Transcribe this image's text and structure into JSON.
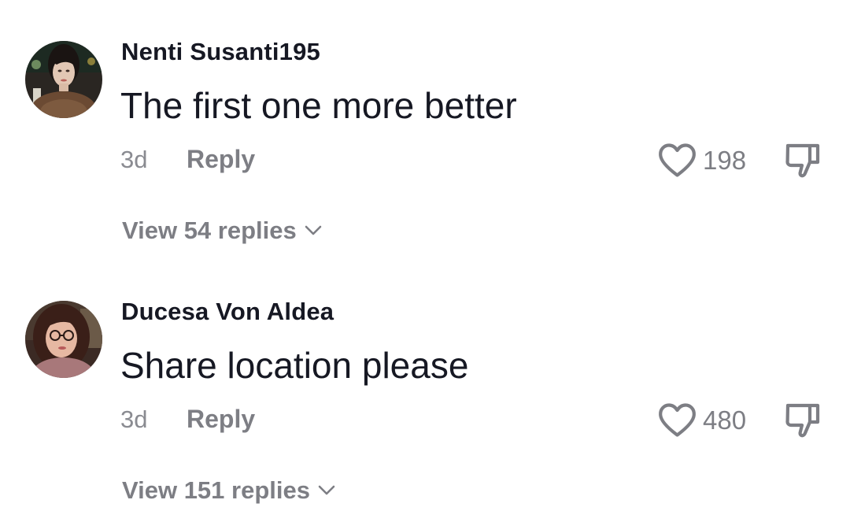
{
  "comments": [
    {
      "username": "Nenti Susanti195",
      "text": "The first one more better",
      "time": "3d",
      "reply_label": "Reply",
      "likes": "198",
      "view_replies": "View 54 replies",
      "avatar_icon": "user-avatar-photo"
    },
    {
      "username": "Ducesa Von Aldea",
      "text": "Share location please",
      "time": "3d",
      "reply_label": "Reply",
      "likes": "480",
      "view_replies": "View 151 replies",
      "avatar_icon": "user-avatar-photo"
    }
  ],
  "icons": {
    "like": "heart-icon",
    "dislike": "thumbs-down-icon",
    "expand": "chevron-down-icon"
  },
  "colors": {
    "primary_text": "#161823",
    "secondary_text": "#7d7e84",
    "icon": "#7d7e84"
  }
}
